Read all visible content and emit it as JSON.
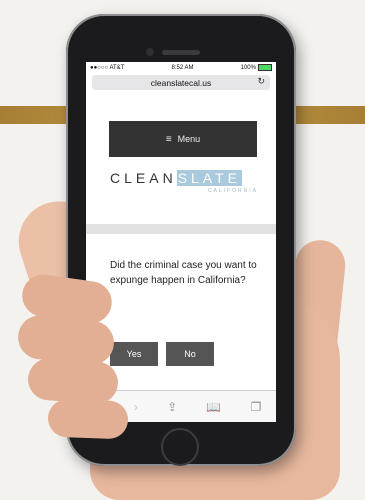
{
  "status_bar": {
    "carrier": "●●○○○ AT&T",
    "time": "8:52 AM",
    "battery": "100%"
  },
  "browser": {
    "url": "cleanslatecal.us",
    "reload_icon": "reload-icon"
  },
  "site": {
    "menu_label": "Menu",
    "logo_part1": "CLEAN",
    "logo_part2": "SLATE",
    "logo_sub": "CALIFORNIA",
    "question": "Did the criminal case you want to expunge happen in California?",
    "yes_label": "Yes",
    "no_label": "No"
  },
  "toolbar": {
    "back": "‹",
    "forward": "›",
    "share": "⇪",
    "bookmarks": "📖",
    "tabs": "❐"
  },
  "colors": {
    "band": "#b08a3a",
    "menu_bg": "#333333",
    "button_bg": "#555555",
    "logo_accent": "#a9c9dd",
    "toolbar_blue": "#4a7bd1"
  }
}
